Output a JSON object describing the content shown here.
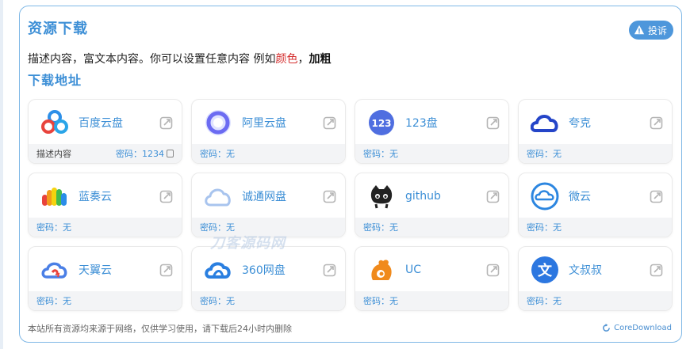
{
  "panel": {
    "title": "资源下载",
    "report_label": "投诉",
    "desc_prefix": "描述内容，富文本内容。你可以设置任意内容 例如",
    "desc_red": "颜色",
    "desc_sep": "，",
    "desc_bold": "加粗",
    "subtitle": "下载地址"
  },
  "cards": [
    {
      "name": "百度云盘",
      "icon": "baidu-cloud-icon",
      "note": "描述内容",
      "password": "密码：1234",
      "copy_icon": "copy-icon"
    },
    {
      "name": "阿里云盘",
      "icon": "aliyun-drive-icon",
      "password": "密码：无"
    },
    {
      "name": "123盘",
      "icon": "123pan-icon",
      "icon_text": "123",
      "password": "密码：无"
    },
    {
      "name": "夸克",
      "icon": "quark-icon",
      "password": "密码：无"
    },
    {
      "name": "蓝奏云",
      "icon": "lanzou-icon",
      "password": "密码：无"
    },
    {
      "name": "诚通网盘",
      "icon": "ctfile-icon",
      "password": "密码：无"
    },
    {
      "name": "github",
      "icon": "github-icon",
      "password": "密码：无"
    },
    {
      "name": "微云",
      "icon": "weiyun-icon",
      "password": "密码：无"
    },
    {
      "name": "天翼云",
      "icon": "tianyi-cloud-icon",
      "password": "密码：无"
    },
    {
      "name": "360网盘",
      "icon": "360pan-icon",
      "password": "密码：无"
    },
    {
      "name": "UC",
      "icon": "uc-icon",
      "password": "密码：无"
    },
    {
      "name": "文叔叔",
      "icon": "wenshushu-icon",
      "icon_text": "文",
      "password": "密码：无"
    }
  ],
  "footer": {
    "disclaimer": "本站所有资源均来源于网络，仅供学习使用，请下载后24小时内删除",
    "brand": "CoreDownload"
  },
  "watermark": "刀客源码网",
  "colors": {
    "accent": "#3d8fd6",
    "red": "#d42f2f",
    "report_bg": "#4e97db"
  }
}
